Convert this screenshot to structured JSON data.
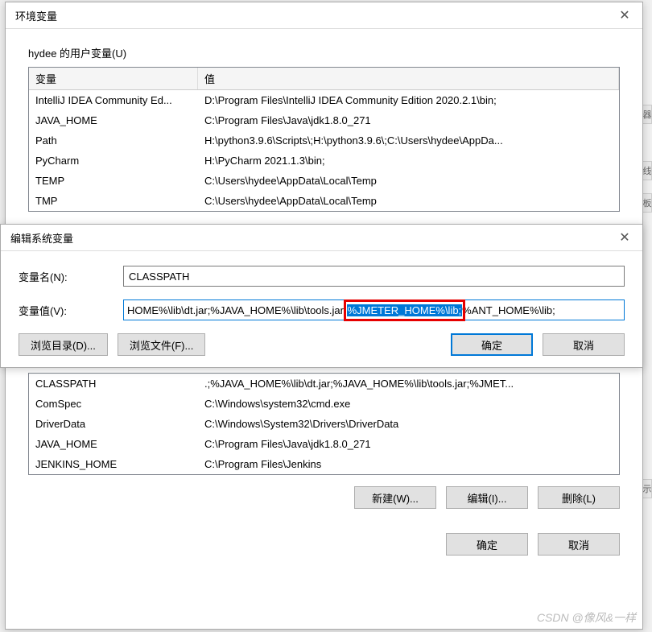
{
  "env_dialog": {
    "title": "环境变量",
    "user_section_label": "hydee 的用户变量(U)",
    "columns": {
      "var": "变量",
      "val": "值"
    },
    "user_rows": [
      {
        "var": "IntelliJ IDEA Community Ed...",
        "val": "D:\\Program Files\\IntelliJ IDEA Community Edition 2020.2.1\\bin;"
      },
      {
        "var": "JAVA_HOME",
        "val": "C:\\Program Files\\Java\\jdk1.8.0_271"
      },
      {
        "var": "Path",
        "val": "H:\\python3.9.6\\Scripts\\;H:\\python3.9.6\\;C:\\Users\\hydee\\AppDa..."
      },
      {
        "var": "PyCharm",
        "val": "H:\\PyCharm 2021.1.3\\bin;"
      },
      {
        "var": "TEMP",
        "val": "C:\\Users\\hydee\\AppData\\Local\\Temp"
      },
      {
        "var": "TMP",
        "val": "C:\\Users\\hydee\\AppData\\Local\\Temp"
      }
    ]
  },
  "edit_dialog": {
    "title": "编辑系统变量",
    "name_label": "变量名(N):",
    "value_label": "变量值(V):",
    "name_value": "CLASSPATH",
    "value_pre": "HOME%\\lib\\dt.jar;%JAVA_HOME%\\lib\\tools.jar;",
    "value_selected": "%JMETER_HOME%\\lib;",
    "value_post": "%ANT_HOME%\\lib;",
    "browse_dir": "浏览目录(D)...",
    "browse_file": "浏览文件(F)...",
    "ok": "确定",
    "cancel": "取消"
  },
  "sys_table": {
    "rows": [
      {
        "var": "CLASSPATH",
        "val": ".;%JAVA_HOME%\\lib\\dt.jar;%JAVA_HOME%\\lib\\tools.jar;%JMET..."
      },
      {
        "var": "ComSpec",
        "val": "C:\\Windows\\system32\\cmd.exe"
      },
      {
        "var": "DriverData",
        "val": "C:\\Windows\\System32\\Drivers\\DriverData"
      },
      {
        "var": "JAVA_HOME",
        "val": "C:\\Program Files\\Java\\jdk1.8.0_271"
      },
      {
        "var": "JENKINS_HOME",
        "val": "C:\\Program Files\\Jenkins"
      }
    ]
  },
  "bottom_buttons": {
    "new": "新建(W)...",
    "edit": "编辑(I)...",
    "delete": "删除(L)",
    "ok": "确定",
    "cancel": "取消"
  },
  "watermark": "CSDN @像风&一样",
  "edge_tabs": [
    "器",
    "线",
    "板",
    "示"
  ]
}
